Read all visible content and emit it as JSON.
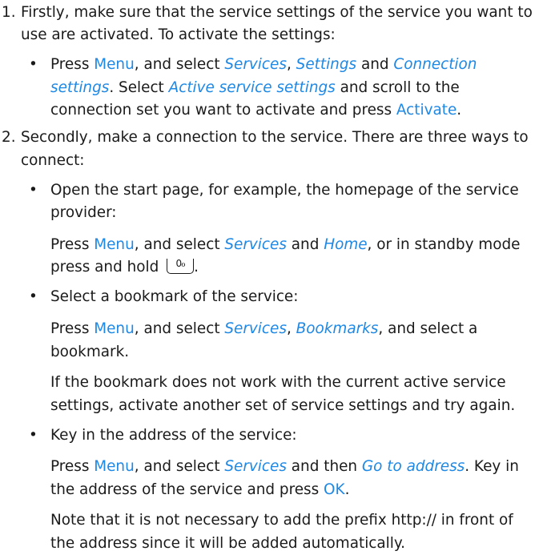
{
  "step1": {
    "num": "1.",
    "l1": "Firstly, make sure that the service settings of the service you want to",
    "l2": "use are activated. To activate the settings:",
    "b1": {
      "t1": "Press ",
      "menu": "Menu",
      "t2": ", and select ",
      "services": "Services",
      "c1": ",",
      "settings": "Settings",
      "and": " and ",
      "conn1": "Connection",
      "conn2": "settings",
      "dot": ". Select ",
      "active": "Active service settings",
      "t3": " and scroll to the",
      "l3a": "connection set you want to activate and press ",
      "activate": "Activate",
      "l3b": "."
    }
  },
  "step2": {
    "num": "2.",
    "l1": "Secondly, make a connection to the service. There are three ways to",
    "l2": "connect:",
    "b1": {
      "l1": "Open the start page, for example, the homepage of the service",
      "l2": "provider:",
      "p1": "Press ",
      "menu": "Menu",
      "p2": ", and select ",
      "services": "Services",
      "p3": " and ",
      "home": "Home",
      "p4": ", or in standby mode",
      "p5": "press and hold ",
      "key_label": "0ℴ",
      "p6": "."
    },
    "b2": {
      "l1": "Select a bookmark of the service:",
      "p1": "Press ",
      "menu": "Menu",
      "p2": ", and select ",
      "services": "Services",
      "c1": ", ",
      "bookmarks": "Bookmarks",
      "p3": ", and select a",
      "p4": "bookmark.",
      "n1": "If the bookmark does not work with the current active service",
      "n2": "settings, activate another set of service settings and try again."
    },
    "b3": {
      "l1": "Key in the address of the service:",
      "p1": "Press ",
      "menu": "Menu",
      "p2": ", and select ",
      "services": "Services",
      "p3": " and then ",
      "goto": "Go to address",
      "p4": ". Key in",
      "p5": "the address of the service and press ",
      "ok": "OK",
      "p6": ".",
      "n1": "Note that it is not necessary to add the prefix http:// in front of",
      "n2": "the address since it will be added automatically."
    }
  },
  "bullet_char": "•"
}
